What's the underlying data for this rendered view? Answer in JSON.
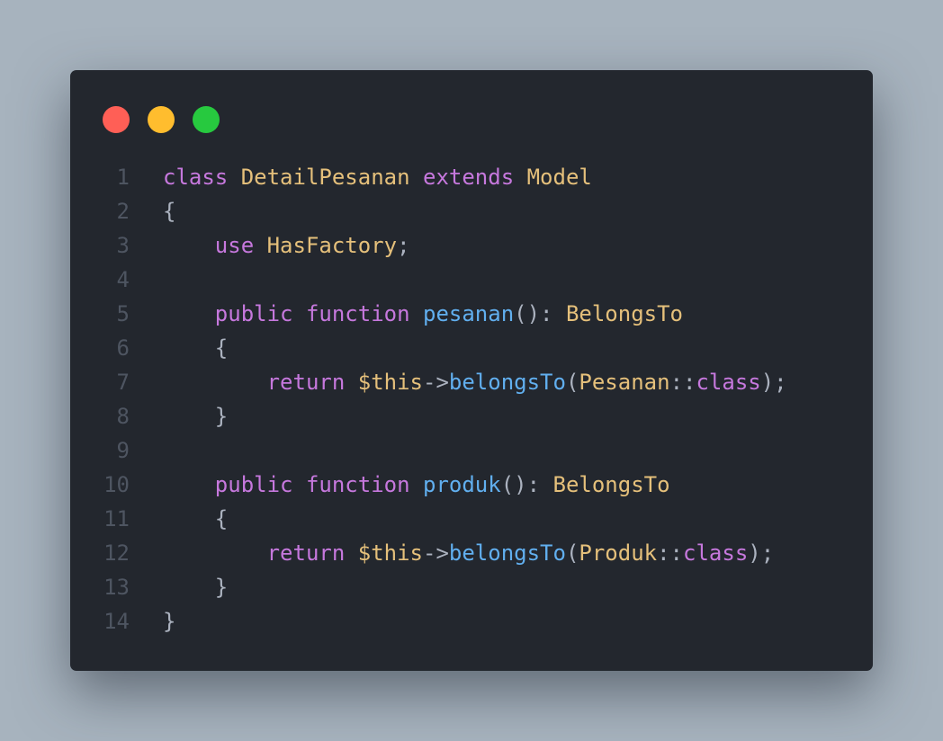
{
  "window": {
    "controls": {
      "close_color": "#ff5f56",
      "minimize_color": "#ffbd2e",
      "maximize_color": "#27c93f"
    }
  },
  "code": {
    "lines": [
      {
        "number": "1",
        "tokens": [
          {
            "text": "class",
            "kind": "keyword"
          },
          {
            "text": " ",
            "kind": "plain"
          },
          {
            "text": "DetailPesanan",
            "kind": "class"
          },
          {
            "text": " ",
            "kind": "plain"
          },
          {
            "text": "extends",
            "kind": "keyword"
          },
          {
            "text": " ",
            "kind": "plain"
          },
          {
            "text": "Model",
            "kind": "class"
          }
        ]
      },
      {
        "number": "2",
        "tokens": [
          {
            "text": "{",
            "kind": "plain"
          }
        ]
      },
      {
        "number": "3",
        "tokens": [
          {
            "text": "    ",
            "kind": "plain"
          },
          {
            "text": "use",
            "kind": "keyword"
          },
          {
            "text": " ",
            "kind": "plain"
          },
          {
            "text": "HasFactory",
            "kind": "class"
          },
          {
            "text": ";",
            "kind": "plain"
          }
        ]
      },
      {
        "number": "4",
        "tokens": []
      },
      {
        "number": "5",
        "tokens": [
          {
            "text": "    ",
            "kind": "plain"
          },
          {
            "text": "public",
            "kind": "keyword"
          },
          {
            "text": " ",
            "kind": "plain"
          },
          {
            "text": "function",
            "kind": "keyword"
          },
          {
            "text": " ",
            "kind": "plain"
          },
          {
            "text": "pesanan",
            "kind": "function"
          },
          {
            "text": "(): ",
            "kind": "plain"
          },
          {
            "text": "BelongsTo",
            "kind": "class"
          }
        ]
      },
      {
        "number": "6",
        "tokens": [
          {
            "text": "    {",
            "kind": "plain"
          }
        ]
      },
      {
        "number": "7",
        "tokens": [
          {
            "text": "        ",
            "kind": "plain"
          },
          {
            "text": "return",
            "kind": "keyword"
          },
          {
            "text": " ",
            "kind": "plain"
          },
          {
            "text": "$this",
            "kind": "class"
          },
          {
            "text": "->",
            "kind": "plain"
          },
          {
            "text": "belongsTo",
            "kind": "function"
          },
          {
            "text": "(",
            "kind": "plain"
          },
          {
            "text": "Pesanan",
            "kind": "class"
          },
          {
            "text": "::",
            "kind": "plain"
          },
          {
            "text": "class",
            "kind": "keyword"
          },
          {
            "text": ");",
            "kind": "plain"
          }
        ]
      },
      {
        "number": "8",
        "tokens": [
          {
            "text": "    }",
            "kind": "plain"
          }
        ]
      },
      {
        "number": "9",
        "tokens": []
      },
      {
        "number": "10",
        "tokens": [
          {
            "text": "    ",
            "kind": "plain"
          },
          {
            "text": "public",
            "kind": "keyword"
          },
          {
            "text": " ",
            "kind": "plain"
          },
          {
            "text": "function",
            "kind": "keyword"
          },
          {
            "text": " ",
            "kind": "plain"
          },
          {
            "text": "produk",
            "kind": "function"
          },
          {
            "text": "(): ",
            "kind": "plain"
          },
          {
            "text": "BelongsTo",
            "kind": "class"
          }
        ]
      },
      {
        "number": "11",
        "tokens": [
          {
            "text": "    {",
            "kind": "plain"
          }
        ]
      },
      {
        "number": "12",
        "tokens": [
          {
            "text": "        ",
            "kind": "plain"
          },
          {
            "text": "return",
            "kind": "keyword"
          },
          {
            "text": " ",
            "kind": "plain"
          },
          {
            "text": "$this",
            "kind": "class"
          },
          {
            "text": "->",
            "kind": "plain"
          },
          {
            "text": "belongsTo",
            "kind": "function"
          },
          {
            "text": "(",
            "kind": "plain"
          },
          {
            "text": "Produk",
            "kind": "class"
          },
          {
            "text": "::",
            "kind": "plain"
          },
          {
            "text": "class",
            "kind": "keyword"
          },
          {
            "text": ");",
            "kind": "plain"
          }
        ]
      },
      {
        "number": "13",
        "tokens": [
          {
            "text": "    }",
            "kind": "plain"
          }
        ]
      },
      {
        "number": "14",
        "tokens": [
          {
            "text": "}",
            "kind": "plain"
          }
        ]
      }
    ]
  }
}
